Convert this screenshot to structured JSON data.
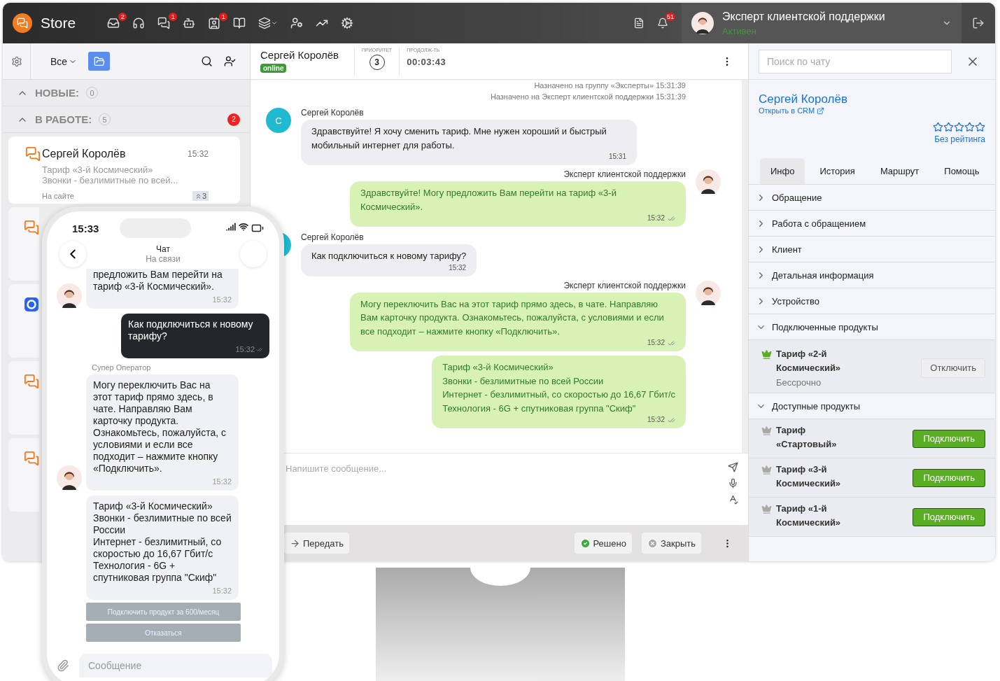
{
  "topbar": {
    "app_name": "Store",
    "nav": [
      {
        "kind": "inbox",
        "badge": "2"
      },
      {
        "kind": "headset"
      },
      {
        "kind": "chats",
        "badge": "1"
      },
      {
        "kind": "bot"
      },
      {
        "kind": "contacts",
        "badge": "1"
      },
      {
        "kind": "book"
      },
      {
        "kind": "layers",
        "dropdown": true
      },
      {
        "kind": "user-settings"
      },
      {
        "kind": "chart"
      },
      {
        "kind": "gears"
      }
    ],
    "notifications": "51",
    "user": {
      "name": "Эксперт клиентской поддержки",
      "status": "Активен"
    }
  },
  "sidebar": {
    "filter": "Все",
    "sections": [
      {
        "label": "НОВЫЕ:",
        "count": "0",
        "expanded": true
      },
      {
        "label": "В РАБОТЕ:",
        "count": "5",
        "expanded": true,
        "unread": "2"
      }
    ],
    "active_chat": {
      "name": "Сергей Королёв",
      "time": "15:32",
      "preview": "Тариф «3-й Космический»",
      "preview_2": "Звонки - безлимитные по всей...",
      "source": "На сайте",
      "priority": "3"
    },
    "other_chats": [
      {
        "kind": "chat"
      },
      {
        "kind": "messenger"
      },
      {
        "kind": "chat"
      },
      {
        "kind": "chat"
      }
    ]
  },
  "chat": {
    "header": {
      "name": "Сергей Королёв",
      "status": "online",
      "priority_label": "ПРИОРИТЕТ",
      "priority": "3",
      "duration_label": "ПРОДОЛЖ-ТЬ",
      "duration": "00:03:43"
    },
    "events": [
      "Назначено на группу «Эксперты» 15:31:39",
      "Назначено на Эксперт клиентской поддержки 15:31:39"
    ],
    "messages": [
      {
        "kind": "incoming",
        "author": "Сергей Королёв",
        "avatar_letter": "С",
        "text": "Здравствуйте! Я хочу сменить тариф. Мне нужен хороший и быстрый мобильный интернет для работы.",
        "time": "15:31"
      },
      {
        "kind": "outgoing",
        "author": "Эксперт клиентской поддержки",
        "text": "Здравствуйте! Могу предложить Вам перейти на тариф «3-й Космический».",
        "time": "15:32",
        "read": true
      },
      {
        "kind": "incoming",
        "author": "Сергей Королёв",
        "text": "Как подключиться к новому тарифу?",
        "time": "15:32"
      },
      {
        "kind": "outgoing",
        "author": "Эксперт клиентской поддержки",
        "text": "Могу переключить Вас на этот тариф прямо здесь, в чате. Направляю Вам карточку продукта. Ознакомьтесь, пожалуйста, с условиями и если все подходит – нажмите кнопку «Подключить».",
        "time": "15:32",
        "read": true
      },
      {
        "kind": "outgoing",
        "text": "Тариф «3-й Космический»\nЗвонки - безлимитные по всей России\nИнтернет - безлимитный, со скоростью до 16,67 Гбит/с\nТехнология - 6G + спутниковая группа \"Скиф\"",
        "time": "15:32",
        "read": true
      }
    ],
    "composer": {
      "placeholder": "Напишите сообщение..."
    },
    "actions": {
      "transfer": "Передать",
      "resolve": "Решено",
      "close": "Закрыть"
    }
  },
  "info": {
    "search_placeholder": "Поиск по чату",
    "client": "Сергей Королёв",
    "crm_link": "Открыть в CRM",
    "stars": 0,
    "rating": "Без рейтинга",
    "tabs": [
      {
        "label": "Инфо",
        "selected": true
      },
      {
        "label": "История",
        "selected": false
      },
      {
        "label": "Маршрут",
        "selected": false
      },
      {
        "label": "Помощь",
        "selected": false
      }
    ],
    "sections": [
      {
        "label": "Обращение",
        "expanded": false
      },
      {
        "label": "Работа с обращением",
        "expanded": false
      },
      {
        "label": "Клиент",
        "expanded": false
      },
      {
        "label": "Детальная информация",
        "expanded": false
      },
      {
        "label": "Устройство",
        "expanded": false
      },
      {
        "label": "Подключенные продукты",
        "expanded": true,
        "products": [
          {
            "kind": "connected",
            "name": "Тариф «2-й Космический»",
            "note": "Бессрочно",
            "action": "Отключить"
          }
        ]
      },
      {
        "label": "Доступные продукты",
        "expanded": true,
        "products": [
          {
            "kind": "available",
            "name": "Тариф «Стартовый»",
            "action": "Подключить"
          },
          {
            "kind": "available",
            "name": "Тариф «3-й Космический»",
            "action": "Подключить"
          },
          {
            "kind": "available",
            "name": "Тариф «1-й Космический»",
            "action": "Подключить"
          }
        ]
      }
    ]
  },
  "phone": {
    "clock": "15:33",
    "title": "Чат",
    "subtitle": "На связи",
    "messages": [
      {
        "kind": "operator",
        "text": "предложить Вам перейти на тариф «3-й Космический».",
        "time": "15:32",
        "avatar": true,
        "cut": true
      },
      {
        "kind": "user",
        "text": "Как подключиться к новому тарифу?",
        "time": "15:32"
      },
      {
        "kind": "caption",
        "text": "Супер Оператор"
      },
      {
        "kind": "operator",
        "text": "Могу переключить Вас на этот тариф прямо здесь, в чате. Направляю Вам карточку продукта. Ознакомьтесь, пожалуйста, с условиями и если все подходит – нажмите кнопку «Подключить».",
        "time": "15:32",
        "avatar": true
      },
      {
        "kind": "operator",
        "text": "Тариф «3-й Космический»\nЗвонки - безлимитные по всей России\nИнтернет - безлимитный, со скоростью до 16,67 Гбит/с\nТехнология - 6G + спутниковая группа \"Скиф\"",
        "time": "15:32"
      }
    ],
    "buttons": [
      "Подключить продукт за 600/месяц",
      "Отказаться"
    ],
    "placeholder": "Сообщение"
  }
}
